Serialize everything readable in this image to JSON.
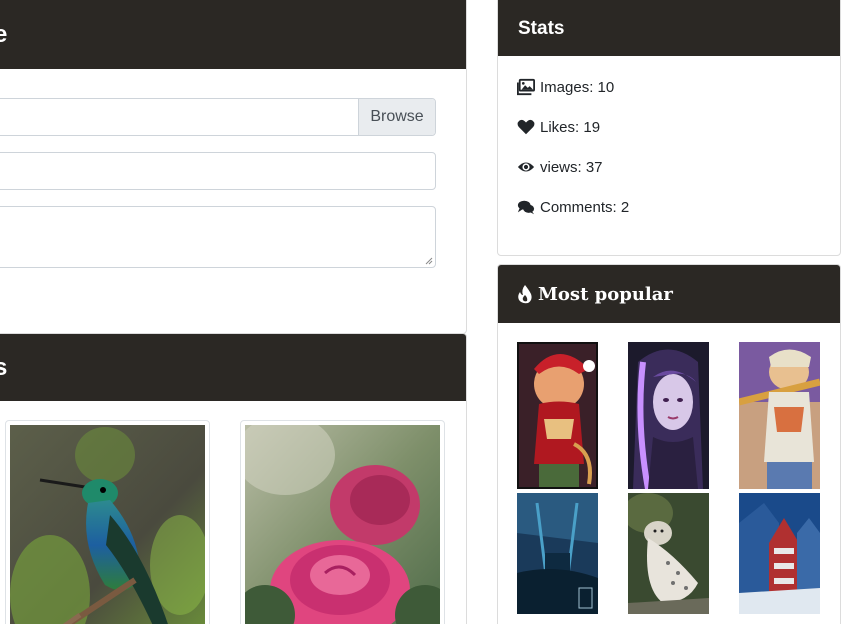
{
  "upload": {
    "header_title": "e",
    "file_browse_label": "Browse"
  },
  "images_section": {
    "header_title": "s",
    "thumbnails": [
      "hummingbird",
      "pink rose"
    ]
  },
  "stats": {
    "header_title": "Stats",
    "items": [
      {
        "icon": "images-icon",
        "label": "Images: 10"
      },
      {
        "icon": "heart-icon",
        "label": "Likes: 19"
      },
      {
        "icon": "eye-icon",
        "label": "views: 37"
      },
      {
        "icon": "comments-icon",
        "label": "Comments: 2"
      }
    ]
  },
  "popular": {
    "header_title": "Most popular",
    "icon": "fire-icon",
    "images": [
      "christmas-archer",
      "purple-hair-portrait",
      "archer-rifle",
      "blue-castle-art",
      "snow-leopard",
      "snowy-town"
    ]
  },
  "colors": {
    "header_bg": "#2b2824",
    "header_text": "#ffffff"
  }
}
